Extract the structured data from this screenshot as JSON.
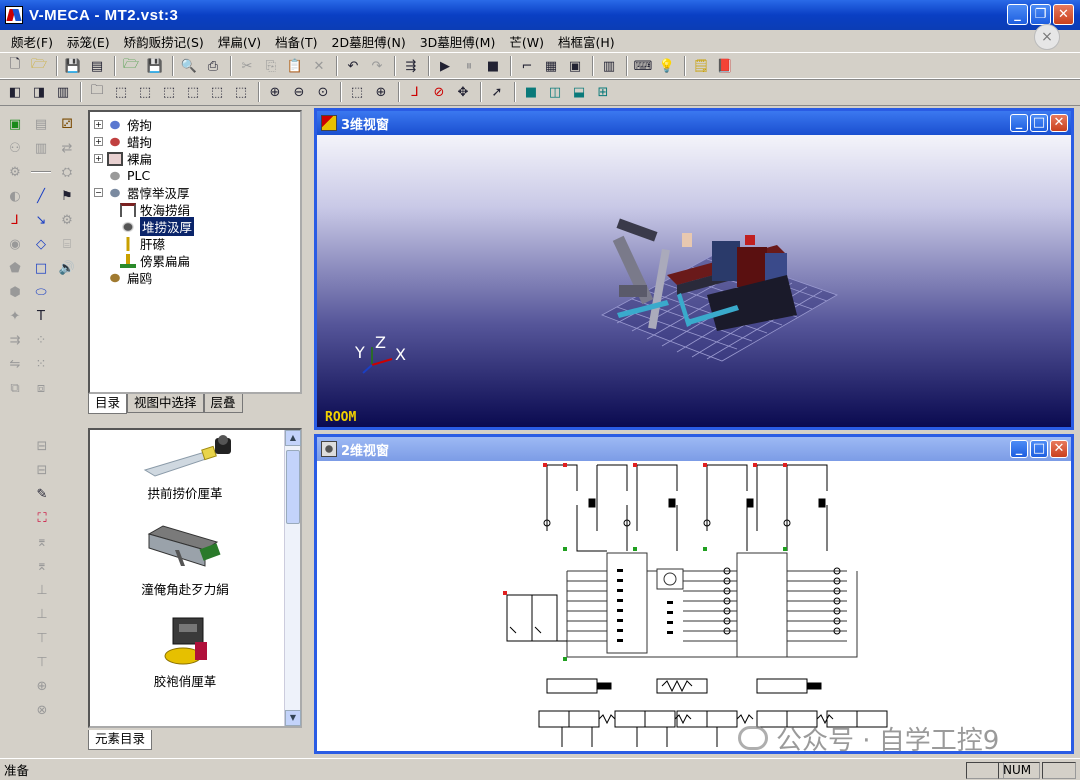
{
  "window": {
    "title": "V-MECA - MT2.vst:3"
  },
  "menu": [
    "颇老(F)",
    "祘笼(E)",
    "矫韵贩捞记(S)",
    "焊扁(V)",
    "档备(T)",
    "2D墓胆傅(N)",
    "3D墓胆傅(M)",
    "芒(W)",
    "档框富(H)"
  ],
  "tree": {
    "items": [
      "傍拘",
      "蜡拘",
      "裸扁",
      "PLC",
      "嚣惇举汲厚",
      "牧海捞绢",
      "堆捞汲厚",
      "肝礤",
      "傍累扁扁",
      "扁鸥"
    ],
    "selected": "堆捞汲厚"
  },
  "tabs": [
    "目录",
    "视图中选择",
    "层叠"
  ],
  "catalog": {
    "items": [
      "拱前捞价厘革",
      "潼俺角赴歹力絹",
      "胶袍俏厘革"
    ],
    "tab": "元素目录"
  },
  "view3d": {
    "title": "3维视窗",
    "label": "ROOM",
    "axes": [
      "Y",
      "Z",
      "X"
    ]
  },
  "view2d": {
    "title": "2维视窗"
  },
  "status": {
    "ready": "准备",
    "num": "NUM"
  },
  "watermark": "公众号 · 自学工控9"
}
